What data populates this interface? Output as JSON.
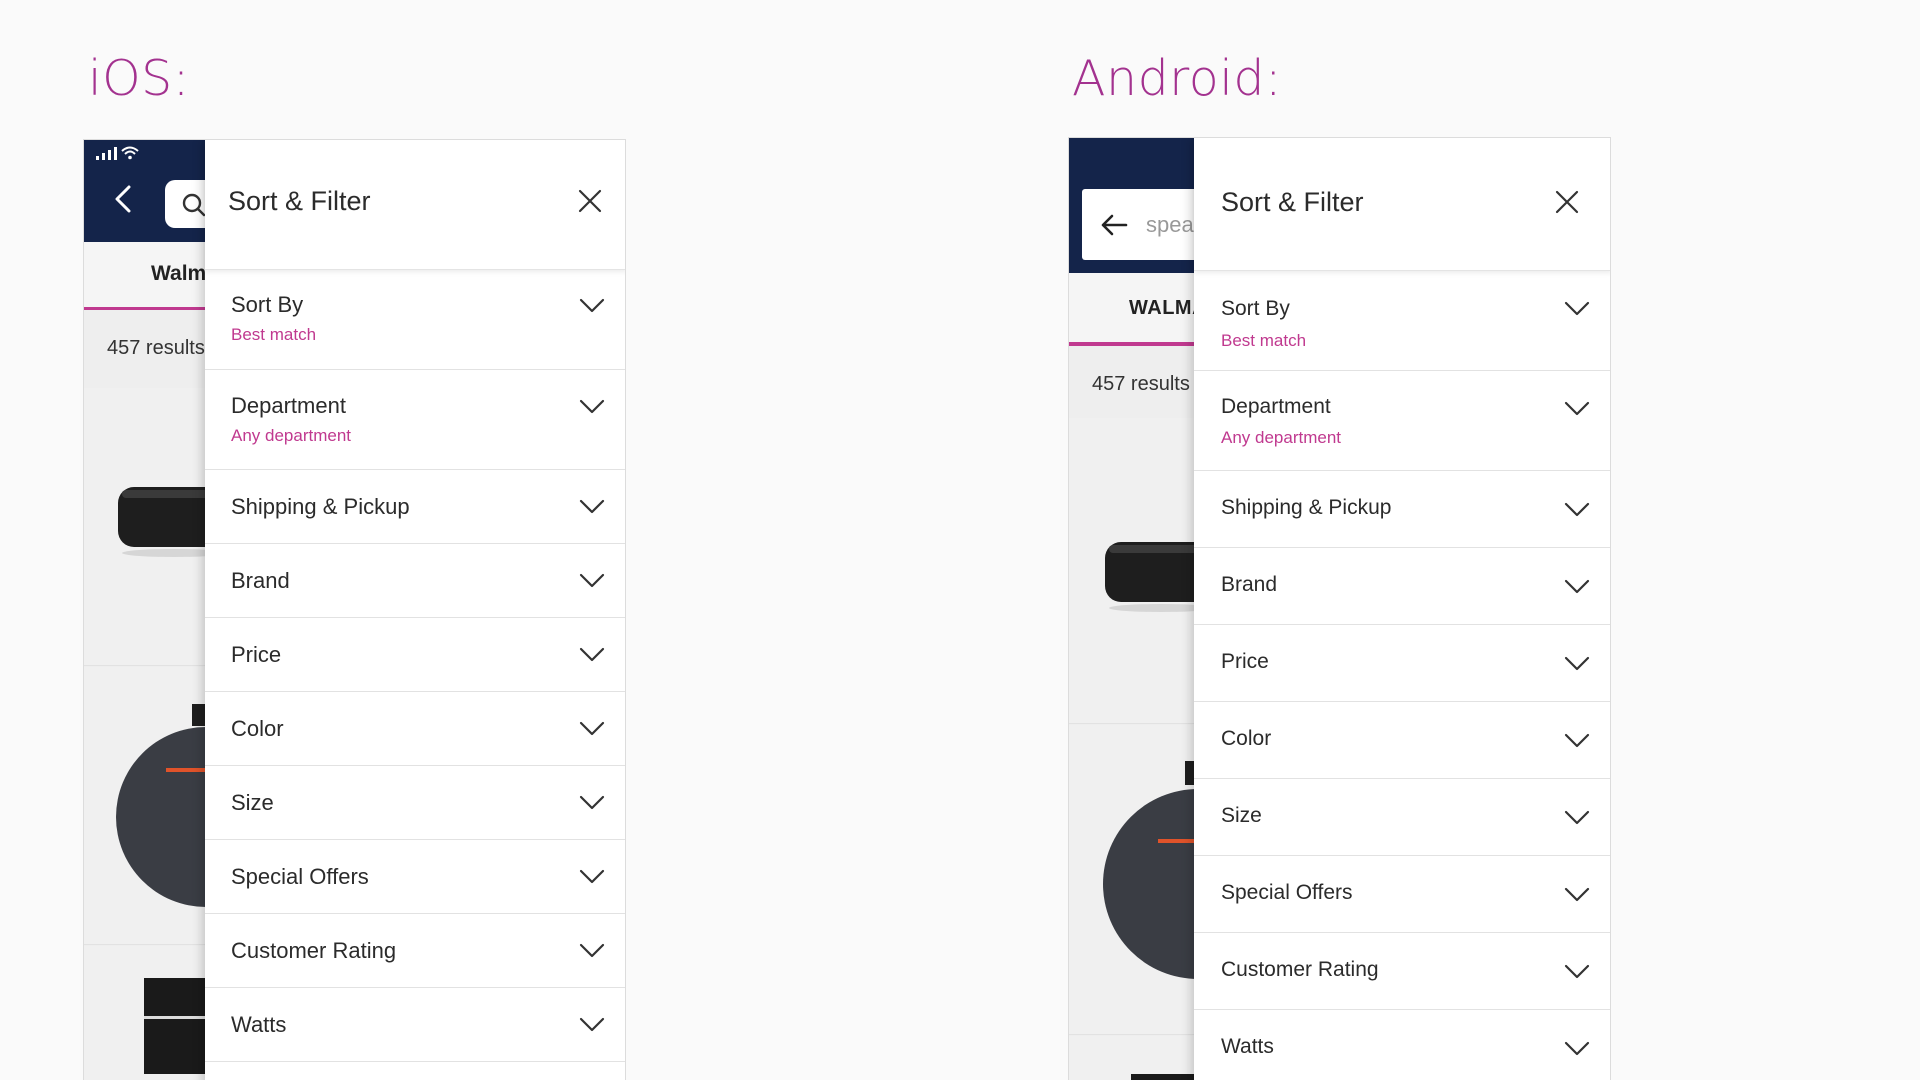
{
  "ios": {
    "platform_label": "iOS:",
    "tab_label": "Walm",
    "results_text": "457 results",
    "panel": {
      "title": "Sort & Filter",
      "rows": [
        {
          "label": "Sort By",
          "sub": "Best match"
        },
        {
          "label": "Department",
          "sub": "Any department"
        },
        {
          "label": "Shipping & Pickup"
        },
        {
          "label": "Brand"
        },
        {
          "label": "Price"
        },
        {
          "label": "Color"
        },
        {
          "label": "Size"
        },
        {
          "label": "Special Offers"
        },
        {
          "label": "Customer Rating"
        },
        {
          "label": "Watts"
        }
      ]
    }
  },
  "android": {
    "platform_label": "Android:",
    "search_text": "spea",
    "tab_label": "WALMA",
    "results_text": "457 results",
    "panel": {
      "title": "Sort & Filter",
      "rows": [
        {
          "label": "Sort By",
          "sub": "Best match"
        },
        {
          "label": "Department",
          "sub": "Any department"
        },
        {
          "label": "Shipping & Pickup"
        },
        {
          "label": "Brand"
        },
        {
          "label": "Price"
        },
        {
          "label": "Color"
        },
        {
          "label": "Size"
        },
        {
          "label": "Special Offers"
        },
        {
          "label": "Customer Rating"
        },
        {
          "label": "Watts"
        }
      ]
    }
  },
  "colors": {
    "accent": "#c0398f",
    "title_accent": "#a3328f",
    "header_navy": "#14244a"
  },
  "icons": {
    "close": "close-icon",
    "expand": "chevron-down-icon",
    "back": "chevron-left-icon",
    "search": "search-icon",
    "arrow_back": "arrow-left-icon"
  }
}
